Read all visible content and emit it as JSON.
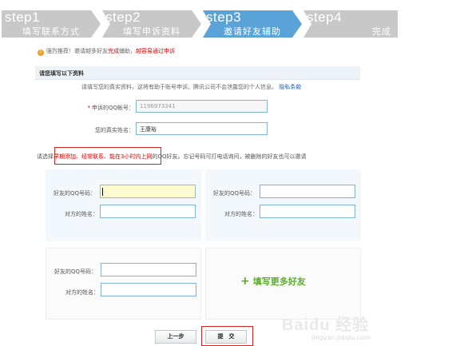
{
  "steps": [
    {
      "num": "step1",
      "name": "填写联系方式",
      "state": "done"
    },
    {
      "num": "step2",
      "name": "填写申诉资料",
      "state": "done"
    },
    {
      "num": "step3",
      "name": "邀请好友辅助",
      "state": "active"
    },
    {
      "num": "step4",
      "name": "完成",
      "state": "todo"
    }
  ],
  "colors": {
    "step_done": "#c8c8c8",
    "step_active": "#5aa3d8",
    "accent_red": "#e00000",
    "accent_green": "#5aae2a"
  },
  "tip": {
    "prefix": "强烈推荐！邀请越多好友",
    "em": "完成",
    "mid": "辅助，",
    "link": "越容易通过申诉",
    "icon": "warning-icon"
  },
  "section": {
    "title": "请您填写以下资料"
  },
  "intro": {
    "text": "请填写您的真实资料，这将有助于账号申诉。腾讯公司不会泄露您的个人信息。",
    "link": "隐私条款"
  },
  "form": {
    "qq_label": "申诉的QQ帐号：",
    "qq_value": "1196973341",
    "name_label": "您的真实姓名：",
    "name_value": "王康裕"
  },
  "hint": {
    "prefix": "请选择",
    "red": "早期添加、经常联系、能在3小时内上网",
    "suffix": "的QQ好友。忘记号码可打电话询问，被删除的好友也可以邀请"
  },
  "friends": {
    "qq_label": "好友的QQ号码：",
    "name_label": "对方的姓名："
  },
  "more": {
    "label": "填写更多好友",
    "icon": "plus-icon"
  },
  "buttons": {
    "prev": "上一步",
    "submit": "提　交"
  },
  "watermark": {
    "brand": "Baidu 经验",
    "url": "jingyan.baidu.com"
  }
}
